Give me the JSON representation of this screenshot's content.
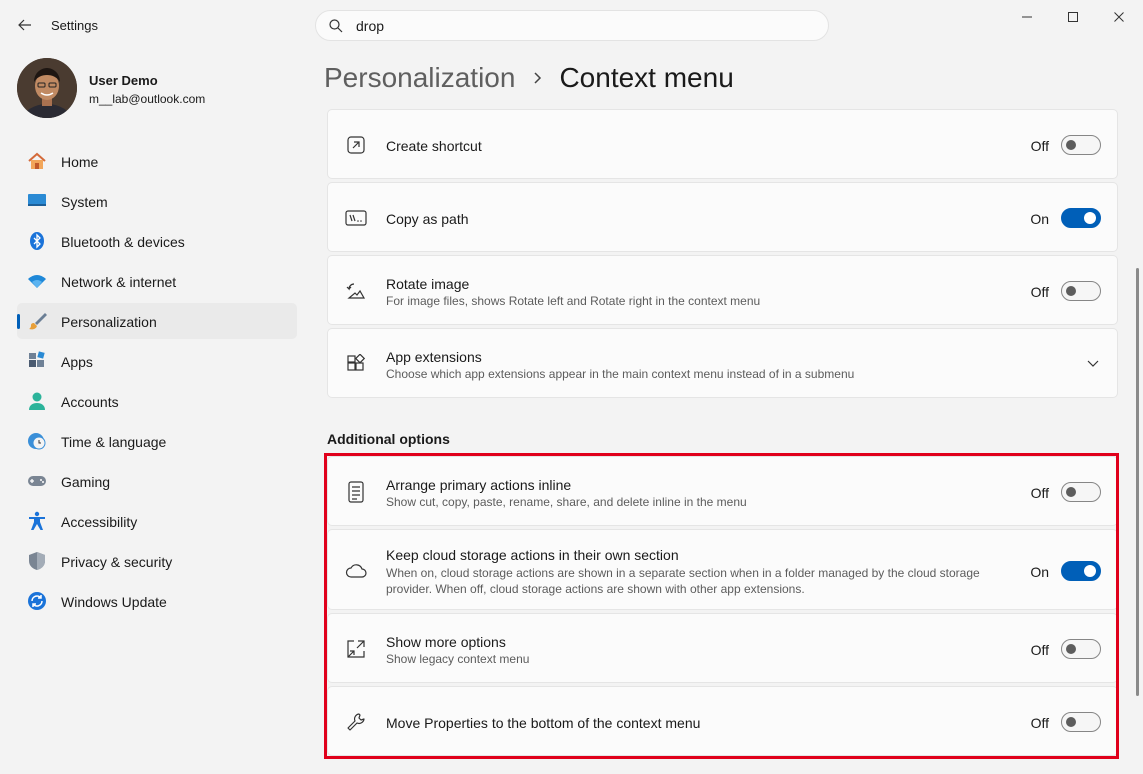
{
  "window": {
    "title": "Settings",
    "controls": {
      "minimize": "minimize-icon",
      "maximize": "maximize-icon",
      "close": "close-icon"
    }
  },
  "search": {
    "value": "drop",
    "icon": "search-icon"
  },
  "user": {
    "name": "User Demo",
    "email": "m__lab@outlook.com"
  },
  "sidebar": {
    "items": [
      {
        "label": "Home",
        "icon": "home-icon"
      },
      {
        "label": "System",
        "icon": "system-icon"
      },
      {
        "label": "Bluetooth & devices",
        "icon": "bluetooth-icon"
      },
      {
        "label": "Network & internet",
        "icon": "wifi-icon"
      },
      {
        "label": "Personalization",
        "icon": "brush-icon",
        "active": true
      },
      {
        "label": "Apps",
        "icon": "apps-icon"
      },
      {
        "label": "Accounts",
        "icon": "accounts-icon"
      },
      {
        "label": "Time & language",
        "icon": "globe-clock-icon"
      },
      {
        "label": "Gaming",
        "icon": "gamepad-icon"
      },
      {
        "label": "Accessibility",
        "icon": "accessibility-icon"
      },
      {
        "label": "Privacy & security",
        "icon": "shield-icon"
      },
      {
        "label": "Windows Update",
        "icon": "update-icon"
      }
    ]
  },
  "breadcrumb": {
    "parent": "Personalization",
    "current": "Context menu"
  },
  "settings": [
    {
      "title": "Create shortcut",
      "state": "Off",
      "on": false,
      "icon": "shortcut-icon"
    },
    {
      "title": "Copy as path",
      "state": "On",
      "on": true,
      "icon": "copy-path-icon"
    },
    {
      "title": "Rotate image",
      "description": "For image files, shows Rotate left and Rotate right in the context menu",
      "state": "Off",
      "on": false,
      "icon": "rotate-image-icon"
    },
    {
      "title": "App extensions",
      "description": "Choose which app extensions appear in the main context menu instead of in a submenu",
      "icon": "app-extensions-icon"
    }
  ],
  "additional": {
    "heading": "Additional options",
    "items": [
      {
        "title": "Arrange primary actions inline",
        "description": "Show cut, copy, paste, rename, share, and delete inline in the menu",
        "state": "Off",
        "on": false,
        "icon": "list-icon"
      },
      {
        "title": "Keep cloud storage actions in their own section",
        "description": "When on, cloud storage actions are shown in a separate section when in a folder managed by the cloud storage provider. When off, cloud storage actions are shown with other app extensions.",
        "state": "On",
        "on": true,
        "icon": "cloud-icon"
      },
      {
        "title": "Show more options",
        "description": "Show legacy context menu",
        "state": "Off",
        "on": false,
        "icon": "expand-icon"
      },
      {
        "title": "Move Properties to the bottom of the context menu",
        "state": "Off",
        "on": false,
        "icon": "wrench-icon"
      }
    ]
  },
  "colors": {
    "accent": "#005fb8",
    "highlight": "#e0001b",
    "background": "#f3f3f3",
    "card": "#fbfbfb"
  }
}
